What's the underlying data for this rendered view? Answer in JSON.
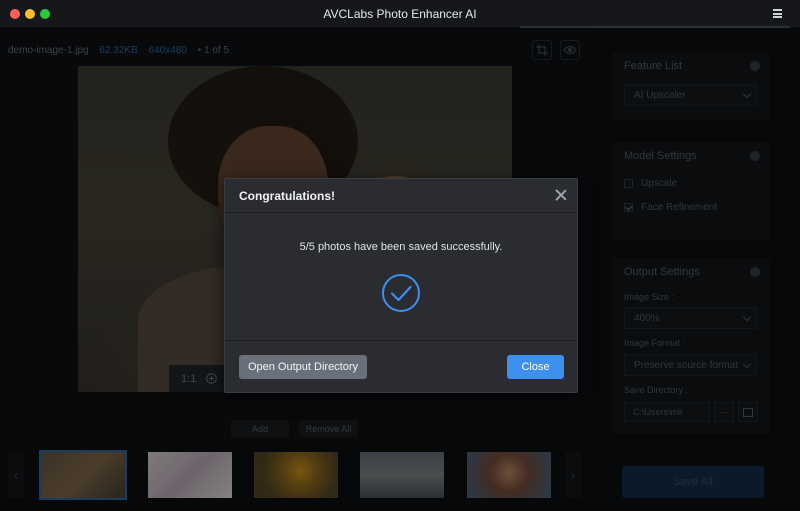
{
  "app": {
    "title": "AVCLabs Photo Enhancer AI"
  },
  "fileinfo": {
    "name": "demo-image-1.jpg",
    "size": "62.32KB",
    "dims": "640x480",
    "index": "1 of 5"
  },
  "preview": {
    "zoom": "1:1"
  },
  "bottom": {
    "add_label": "Add",
    "remove_all_label": "Remove All"
  },
  "feature_list": {
    "title": "Feature List",
    "selected": "AI Upscaler"
  },
  "model_settings": {
    "title": "Model Settings",
    "upscale_label": "Upscale",
    "upscale_checked": false,
    "face_refinement_label": "Face Refinement",
    "face_refinement_checked": true
  },
  "output_settings": {
    "title": "Output Settings",
    "image_size_label": "Image Size :",
    "image_size_value": "400%",
    "image_format_label": "Image Format :",
    "image_format_value": "Preserve source format",
    "save_directory_label": "Save Directory :",
    "save_directory_value": "C:\\Users\\mir",
    "browse_label": "···"
  },
  "save_all_label": "Save All",
  "modal": {
    "title": "Congratulations!",
    "message": "5/5 photos have been saved successfully.",
    "open_button": "Open Output Directory",
    "close_button": "Close"
  },
  "colors": {
    "accent": "#3d8ff0",
    "modal_bg": "#2a2c31",
    "secondary_button": "#6a7079"
  }
}
